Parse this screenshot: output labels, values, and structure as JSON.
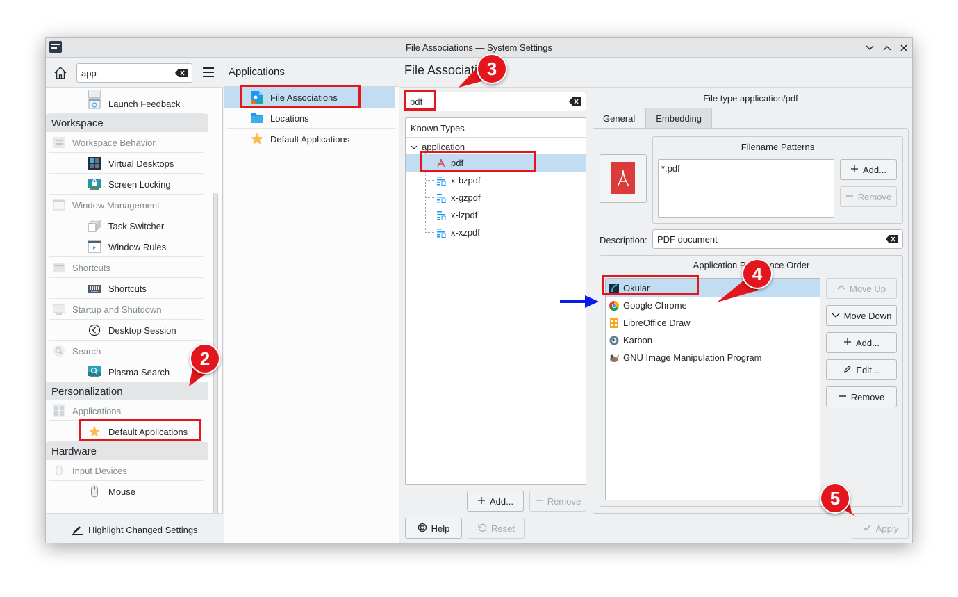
{
  "window": {
    "title": "File Associations — System Settings"
  },
  "sidebar": {
    "search_value": "app",
    "items": [
      {
        "type": "sub",
        "label": "Launch Feedback",
        "icon": "launch-feedback-icon"
      },
      {
        "type": "cat",
        "label": "Workspace"
      },
      {
        "type": "grp",
        "label": "Workspace Behavior",
        "icon": "workspace-behavior-icon"
      },
      {
        "type": "sub",
        "label": "Virtual Desktops",
        "icon": "virtual-desktops-icon"
      },
      {
        "type": "sub",
        "label": "Screen Locking",
        "icon": "screen-locking-icon"
      },
      {
        "type": "grp",
        "label": "Window Management",
        "icon": "window-management-icon"
      },
      {
        "type": "sub",
        "label": "Task Switcher",
        "icon": "task-switcher-icon"
      },
      {
        "type": "sub",
        "label": "Window Rules",
        "icon": "window-rules-icon"
      },
      {
        "type": "grp",
        "label": "Shortcuts",
        "icon": "shortcuts-group-icon"
      },
      {
        "type": "sub",
        "label": "Shortcuts",
        "icon": "keyboard-icon"
      },
      {
        "type": "grp",
        "label": "Startup and Shutdown",
        "icon": "startup-shutdown-icon"
      },
      {
        "type": "sub",
        "label": "Desktop Session",
        "icon": "desktop-session-icon"
      },
      {
        "type": "grp",
        "label": "Search",
        "icon": "search-group-icon"
      },
      {
        "type": "sub",
        "label": "Plasma Search",
        "icon": "plasma-search-icon"
      },
      {
        "type": "cat",
        "label": "Personalization"
      },
      {
        "type": "grp",
        "label": "Applications",
        "icon": "applications-group-icon"
      },
      {
        "type": "sub",
        "label": "Default Applications",
        "icon": "star-icon"
      },
      {
        "type": "cat",
        "label": "Hardware"
      },
      {
        "type": "grp",
        "label": "Input Devices",
        "icon": "input-devices-icon"
      },
      {
        "type": "sub",
        "label": "Mouse",
        "icon": "mouse-icon"
      }
    ],
    "footer_label": "Highlight Changed Settings"
  },
  "middle": {
    "title": "Applications",
    "items": [
      {
        "label": "File Associations",
        "icon": "file-associations-icon",
        "selected": true
      },
      {
        "label": "Locations",
        "icon": "folder-icon",
        "selected": false
      },
      {
        "label": "Default Applications",
        "icon": "star-icon",
        "selected": false
      }
    ]
  },
  "main": {
    "title": "File Associati",
    "filter_value": "pdf",
    "tree_header": "Known Types",
    "tree_root": "application",
    "tree_children": [
      "pdf",
      "x-bzpdf",
      "x-gzpdf",
      "x-lzpdf",
      "x-xzpdf"
    ],
    "add_label": "Add...",
    "remove_label": "Remove",
    "file_type_label": "File type application/pdf",
    "tabs": [
      "General",
      "Embedding"
    ],
    "filename_patterns_title": "Filename Patterns",
    "patterns": [
      "*.pdf"
    ],
    "pattern_add_label": "Add...",
    "pattern_remove_label": "Remove",
    "description_label": "Description:",
    "description_value": "PDF document",
    "apo_title": "Application Preference Order",
    "apps": [
      {
        "label": "Okular",
        "icon": "okular-icon"
      },
      {
        "label": "Google Chrome",
        "icon": "chrome-icon"
      },
      {
        "label": "LibreOffice Draw",
        "icon": "libreoffice-draw-icon"
      },
      {
        "label": "Karbon",
        "icon": "karbon-icon"
      },
      {
        "label": "GNU Image Manipulation Program",
        "icon": "gimp-icon"
      }
    ],
    "move_up_label": "Move Up",
    "move_down_label": "Move Down",
    "app_add_label": "Add...",
    "app_edit_label": "Edit...",
    "app_remove_label": "Remove",
    "help_label": "Help",
    "reset_label": "Reset",
    "apply_label": "Apply"
  },
  "annotations": {
    "badges": [
      "2",
      "3",
      "4",
      "5"
    ]
  },
  "colors": {
    "selection": "#c2ddf2",
    "annotation_red": "#e3161d",
    "arrow_blue": "#0a1be6"
  }
}
